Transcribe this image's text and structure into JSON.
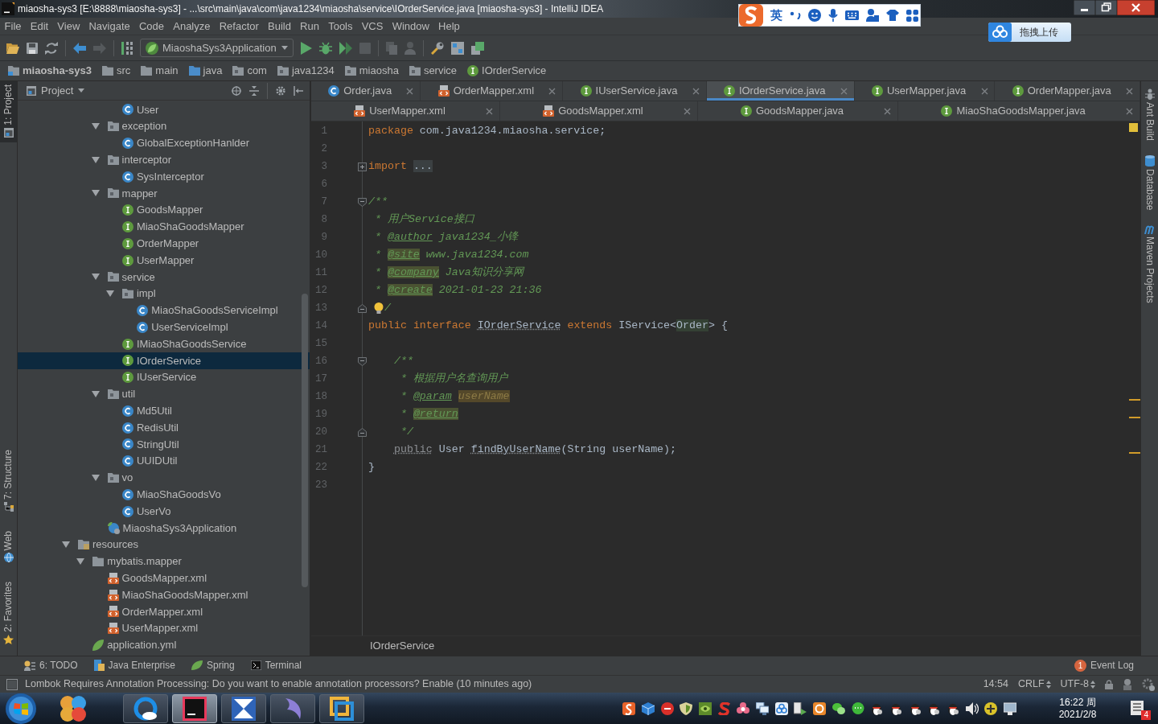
{
  "window": {
    "title": "miaosha-sys3 [E:\\8888\\miaosha-sys3] - ...\\src\\main\\java\\com\\java1234\\miaosha\\service\\IOrderService.java [miaosha-sys3] - IntelliJ IDEA"
  },
  "ime_bar": {
    "mode": "英"
  },
  "upload_button": {
    "label": "拖拽上传"
  },
  "menu": [
    "File",
    "Edit",
    "View",
    "Navigate",
    "Code",
    "Analyze",
    "Refactor",
    "Build",
    "Run",
    "Tools",
    "VCS",
    "Window",
    "Help"
  ],
  "toolbar": {
    "run_config": "MiaoshaSys3Application"
  },
  "breadcrumb": [
    {
      "label": "miaosha-sys3",
      "kind": "project"
    },
    {
      "label": "src",
      "kind": "folder"
    },
    {
      "label": "main",
      "kind": "folder"
    },
    {
      "label": "java",
      "kind": "source"
    },
    {
      "label": "com",
      "kind": "package"
    },
    {
      "label": "java1234",
      "kind": "package"
    },
    {
      "label": "miaosha",
      "kind": "package"
    },
    {
      "label": "service",
      "kind": "package"
    },
    {
      "label": "IOrderService",
      "kind": "interface"
    }
  ],
  "left_strip": {
    "top": [
      {
        "label": "1: Project",
        "kind": "project",
        "selected": true
      }
    ],
    "bottom": [
      {
        "label": "7: Structure",
        "kind": "structure",
        "selected": false
      },
      {
        "label": "Web",
        "kind": "web",
        "selected": false
      },
      {
        "label": "2: Favorites",
        "kind": "favorites",
        "selected": false
      }
    ]
  },
  "project": {
    "title": "Project",
    "tree": [
      {
        "children": [
          {
            "children": [
              {
                "children": [
                  {
                    "label": "User",
                    "kind": "class",
                    "selected": false
                  }
                ]
              },
              {
                "label": "exception",
                "kind": "package",
                "expanded": true,
                "selected": false,
                "children": [
                  {
                    "label": "GlobalExceptionHanlder",
                    "kind": "class",
                    "selected": false
                  }
                ]
              },
              {
                "label": "interceptor",
                "kind": "package",
                "expanded": true,
                "selected": false,
                "children": [
                  {
                    "label": "SysInterceptor",
                    "kind": "class",
                    "selected": false
                  }
                ]
              },
              {
                "label": "mapper",
                "kind": "package",
                "expanded": true,
                "selected": false,
                "children": [
                  {
                    "label": "GoodsMapper",
                    "kind": "interface",
                    "selected": false
                  },
                  {
                    "label": "MiaoShaGoodsMapper",
                    "kind": "interface",
                    "selected": false
                  },
                  {
                    "label": "OrderMapper",
                    "kind": "interface",
                    "selected": false
                  },
                  {
                    "label": "UserMapper",
                    "kind": "interface",
                    "selected": false
                  }
                ]
              },
              {
                "label": "service",
                "kind": "package",
                "expanded": true,
                "selected": false,
                "children": [
                  {
                    "label": "impl",
                    "kind": "package",
                    "expanded": true,
                    "selected": false,
                    "children": [
                      {
                        "label": "MiaoShaGoodsServiceImpl",
                        "kind": "class",
                        "selected": false
                      },
                      {
                        "label": "UserServiceImpl",
                        "kind": "class",
                        "selected": false
                      }
                    ]
                  },
                  {
                    "label": "IMiaoShaGoodsService",
                    "kind": "interface",
                    "selected": false
                  },
                  {
                    "label": "IOrderService",
                    "kind": "interface",
                    "selected": true
                  },
                  {
                    "label": "IUserService",
                    "kind": "interface",
                    "selected": false
                  }
                ]
              },
              {
                "label": "util",
                "kind": "package",
                "expanded": true,
                "selected": false,
                "children": [
                  {
                    "label": "Md5Util",
                    "kind": "class",
                    "selected": false
                  },
                  {
                    "label": "RedisUtil",
                    "kind": "class",
                    "selected": false
                  },
                  {
                    "label": "StringUtil",
                    "kind": "class",
                    "selected": false
                  },
                  {
                    "label": "UUIDUtil",
                    "kind": "class",
                    "selected": false
                  }
                ]
              },
              {
                "label": "vo",
                "kind": "package",
                "expanded": true,
                "selected": false,
                "children": [
                  {
                    "label": "MiaoShaGoodsVo",
                    "kind": "class",
                    "selected": false
                  },
                  {
                    "label": "UserVo",
                    "kind": "class",
                    "selected": false
                  }
                ]
              },
              {
                "label": "MiaoshaSys3Application",
                "kind": "app",
                "selected": false
              }
            ]
          }
        ]
      },
      {
        "label": "resources",
        "kind": "resources",
        "expanded": true,
        "selected": false,
        "children": [
          {
            "label": "mybatis.mapper",
            "kind": "folder",
            "expanded": true,
            "selected": false,
            "children": [
              {
                "label": "GoodsMapper.xml",
                "kind": "xml",
                "selected": false
              },
              {
                "label": "MiaoShaGoodsMapper.xml",
                "kind": "xml",
                "selected": false
              },
              {
                "label": "OrderMapper.xml",
                "kind": "xml",
                "selected": false
              },
              {
                "label": "UserMapper.xml",
                "kind": "xml",
                "selected": false
              }
            ]
          },
          {
            "label": "application.yml",
            "kind": "yml",
            "selected": false
          }
        ]
      }
    ]
  },
  "editor": {
    "tab_rows": [
      [
        {
          "label": "Order.java",
          "kind": "class",
          "selected": false
        },
        {
          "label": "OrderMapper.xml",
          "kind": "xml",
          "selected": false
        },
        {
          "label": "IUserService.java",
          "kind": "interface",
          "selected": false
        },
        {
          "label": "IOrderService.java",
          "kind": "interface",
          "selected": true
        },
        {
          "label": "UserMapper.java",
          "kind": "interface",
          "selected": false
        },
        {
          "label": "OrderMapper.java",
          "kind": "interface",
          "selected": false
        }
      ],
      [
        {
          "label": "UserMapper.xml",
          "kind": "xml",
          "selected": false
        },
        {
          "label": "GoodsMapper.xml",
          "kind": "xml",
          "selected": false
        },
        {
          "label": "GoodsMapper.java",
          "kind": "interface",
          "selected": false
        },
        {
          "label": "MiaoShaGoodsMapper.java",
          "kind": "interface",
          "selected": false
        }
      ]
    ],
    "lines": [
      {
        "number": "1",
        "kind": "text",
        "tokens": [
          {
            "text": "package",
            "kind": "keyword"
          },
          {
            "text": " com.java1234.miaosha.service;",
            "kind": "plain"
          }
        ]
      },
      {
        "number": "2",
        "kind": "text"
      },
      {
        "number": "3",
        "kind": "folded",
        "tokens": [
          {
            "text": "import",
            "kind": "keyword"
          },
          {
            "text": " ...",
            "kind": "folded"
          }
        ]
      },
      {
        "number": "6",
        "kind": "text"
      },
      {
        "number": "7",
        "kind": "fold_start",
        "tokens": [
          {
            "text": "/**",
            "kind": "doc"
          }
        ]
      },
      {
        "number": "8",
        "kind": "text",
        "tokens": [
          {
            "text": " * 用户Service接口",
            "kind": "doc"
          }
        ]
      },
      {
        "number": "9",
        "kind": "text",
        "tokens": [
          {
            "text": " * ",
            "kind": "doc"
          },
          {
            "text": "@author",
            "kind": "doc_tag"
          },
          {
            "text": " java1234_小锋",
            "kind": "doc"
          }
        ]
      },
      {
        "number": "10",
        "kind": "text",
        "tokens": [
          {
            "text": " * ",
            "kind": "doc"
          },
          {
            "text": "@site",
            "kind": "doc_tag_warning"
          },
          {
            "text": " www.java1234.com",
            "kind": "doc"
          }
        ]
      },
      {
        "number": "11",
        "kind": "text",
        "tokens": [
          {
            "text": " * ",
            "kind": "doc"
          },
          {
            "text": "@company",
            "kind": "doc_tag_warning"
          },
          {
            "text": " Java知识分享网",
            "kind": "doc"
          }
        ]
      },
      {
        "number": "12",
        "kind": "text",
        "tokens": [
          {
            "text": " * ",
            "kind": "doc"
          },
          {
            "text": "@create",
            "kind": "doc_tag_warning"
          },
          {
            "text": " 2021-01-23 21:36",
            "kind": "doc"
          }
        ]
      },
      {
        "number": "13",
        "kind": "fold_end",
        "bulb": true,
        "tokens": [
          {
            "text": "/",
            "kind": "doc"
          }
        ]
      },
      {
        "number": "14",
        "kind": "text",
        "tokens": [
          {
            "text": "public",
            "kind": "keyword"
          },
          {
            "text": " interface",
            "kind": "keyword"
          },
          {
            "text": " IOrderService",
            "kind": "unused"
          },
          {
            "text": " extends",
            "kind": "keyword"
          },
          {
            "text": " IService<",
            "kind": "plain"
          },
          {
            "text": "Order",
            "kind": "reference"
          },
          {
            "text": "> {",
            "kind": "plain"
          }
        ]
      },
      {
        "number": "15",
        "kind": "text"
      },
      {
        "number": "16",
        "kind": "fold_start",
        "tokens": [
          {
            "text": "    /**",
            "kind": "doc"
          }
        ]
      },
      {
        "number": "17",
        "kind": "text",
        "tokens": [
          {
            "text": "     * 根据用户名查询用户",
            "kind": "doc"
          }
        ]
      },
      {
        "number": "18",
        "kind": "text",
        "warning": true,
        "tokens": [
          {
            "text": "     * ",
            "kind": "doc"
          },
          {
            "text": "@param",
            "kind": "doc_tag"
          },
          {
            "text": " userName",
            "kind": "doc_param_warning"
          }
        ]
      },
      {
        "number": "19",
        "kind": "text",
        "warning": true,
        "tokens": [
          {
            "text": "     * ",
            "kind": "doc"
          },
          {
            "text": "@return",
            "kind": "doc_tag_warning"
          }
        ]
      },
      {
        "number": "20",
        "kind": "fold_end",
        "tokens": [
          {
            "text": "     */",
            "kind": "doc"
          }
        ]
      },
      {
        "number": "21",
        "kind": "text",
        "warning": true,
        "tokens": [
          {
            "text": "    public",
            "kind": "redundant"
          },
          {
            "text": " User ",
            "kind": "plain"
          },
          {
            "text": "findByUserName",
            "kind": "unused"
          },
          {
            "text": "(String userName);",
            "kind": "plain"
          }
        ]
      },
      {
        "number": "22",
        "kind": "text",
        "tokens": [
          {
            "text": "}",
            "kind": "plain"
          }
        ]
      },
      {
        "number": "23",
        "kind": "text"
      }
    ],
    "breadcrumb": "IOrderService"
  },
  "right_strip": [
    {
      "label": "Ant Build",
      "kind": "ant",
      "selected": false
    },
    {
      "label": "Database",
      "kind": "database",
      "selected": false
    },
    {
      "label": "Maven Projects",
      "kind": "maven",
      "selected": false
    }
  ],
  "tool_windows": [
    {
      "label": "6: TODO",
      "kind": "todo"
    },
    {
      "label": "Java Enterprise",
      "kind": "javaee"
    },
    {
      "label": "Spring",
      "kind": "spring"
    },
    {
      "label": "Terminal",
      "kind": "terminal"
    }
  ],
  "event_log": {
    "label": "Event Log",
    "count": "1"
  },
  "status_bar": {
    "message": "Lombok Requires Annotation Processing: Do you want to enable annotation processors? Enable (10 minutes ago)",
    "position": "14:54",
    "line_separator": "CRLF",
    "encoding": "UTF-8"
  },
  "taskbar": {
    "apps": [
      {
        "running": false,
        "selected": false
      },
      {
        "running": true,
        "selected": false
      },
      {
        "running": true,
        "selected": true
      },
      {
        "running": true,
        "selected": false
      },
      {
        "running": true,
        "selected": false
      },
      {
        "running": true,
        "selected": false
      }
    ],
    "clock": {
      "time": "16:22 周",
      "date": "2021/2/8"
    },
    "notifications": "4"
  }
}
